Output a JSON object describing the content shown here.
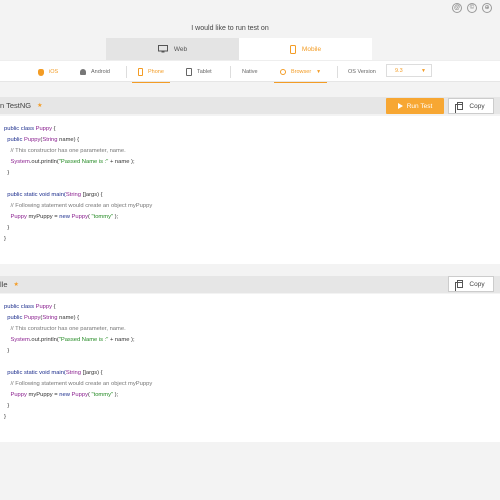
{
  "top_icons": [
    "@",
    "©",
    "⊕"
  ],
  "prompt": "I would like to run test on",
  "platform_tabs": [
    {
      "label": "Web",
      "icon": "monitor-icon",
      "active": false
    },
    {
      "label": "Mobile",
      "icon": "mobile-icon",
      "active": true
    }
  ],
  "options": {
    "ios": "iOS",
    "android": "Android",
    "phone": "Phone",
    "tablet": "Tablet",
    "native": "Native",
    "browser": "Browser",
    "os_version_label": "OS Version",
    "os_version_value": "9.3"
  },
  "colors": {
    "accent": "#f39c25",
    "keyword": "#1a2c8c",
    "class": "#8a1f8f",
    "comment": "#777777",
    "string": "#238a23"
  },
  "block1": {
    "title": "n  TestNG",
    "run_label": "Run Test",
    "copy_label": "Copy",
    "lines": [
      [
        "public class ",
        "Puppy",
        " {"
      ],
      [
        "  public ",
        "Puppy",
        "(",
        "String",
        " name) {"
      ],
      [
        "    // This constructor has one parameter, name."
      ],
      [
        "    ",
        "System",
        ".out.println(",
        "\"Passed Name is :\"",
        " + name );"
      ],
      [
        "  }"
      ],
      [
        ""
      ],
      [
        "  public static void main(",
        "String",
        " []args) {"
      ],
      [
        "    // Following statement would create an object myPuppy"
      ],
      [
        "    ",
        "Puppy",
        " myPuppy = ",
        "new",
        " ",
        "Puppy",
        "( ",
        "\"tommy\"",
        " );"
      ],
      [
        "  }"
      ],
      [
        "}"
      ]
    ]
  },
  "block2": {
    "title": "lle",
    "copy_label": "Copy",
    "lines": [
      [
        "public class ",
        "Puppy",
        " {"
      ],
      [
        "  public ",
        "Puppy",
        "(",
        "String",
        " name) {"
      ],
      [
        "    // This constructor has one parameter, name."
      ],
      [
        "    ",
        "System",
        ".out.println(",
        "\"Passed Name is :\"",
        " + name );"
      ],
      [
        "  }"
      ],
      [
        ""
      ],
      [
        "  public static void main(",
        "String",
        " []args) {"
      ],
      [
        "    // Following statement would create an object myPuppy"
      ],
      [
        "    ",
        "Puppy",
        " myPuppy = ",
        "new",
        " ",
        "Puppy",
        "( ",
        "\"tommy\"",
        " );"
      ],
      [
        "  }"
      ],
      [
        "}"
      ]
    ]
  }
}
